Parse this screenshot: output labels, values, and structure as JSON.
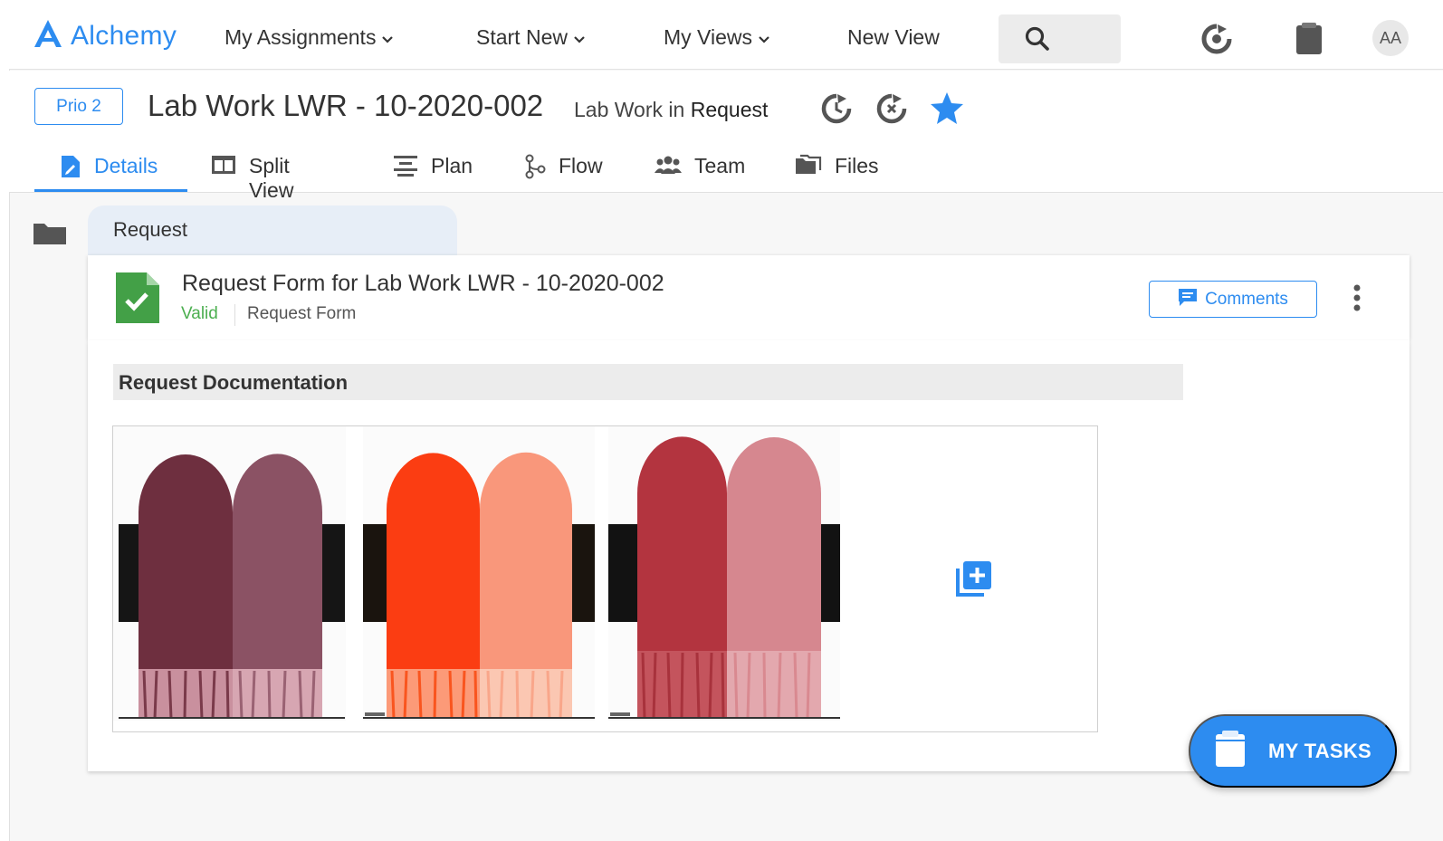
{
  "topnav": {
    "brand": "Alchemy",
    "items": [
      {
        "label": "My Assignments",
        "dropdown": true
      },
      {
        "label": "Start New",
        "dropdown": true
      },
      {
        "label": "My Views",
        "dropdown": true
      },
      {
        "label": "New View",
        "dropdown": false
      }
    ],
    "avatar_initials": "AA"
  },
  "header": {
    "priority": "Prio 2",
    "title": "Lab Work LWR - 10-2020-002",
    "subtitle_prefix": "Lab Work in",
    "subtitle_status": "Request"
  },
  "tabs": [
    {
      "label": "Details",
      "icon": "document-edit-icon",
      "active": true
    },
    {
      "label": "Split View",
      "icon": "split-view-icon",
      "active": false
    },
    {
      "label": "Plan",
      "icon": "plan-icon",
      "active": false
    },
    {
      "label": "Flow",
      "icon": "flow-icon",
      "active": false
    },
    {
      "label": "Team",
      "icon": "team-icon",
      "active": false
    },
    {
      "label": "Files",
      "icon": "files-icon",
      "active": false
    }
  ],
  "section": {
    "label": "Request"
  },
  "form": {
    "title": "Request Form for Lab Work LWR - 10-2020-002",
    "status": "Valid",
    "type": "Request Form",
    "comments_label": "Comments"
  },
  "documentation": {
    "heading": "Request Documentation",
    "swatches": [
      {
        "dark": "#6e2f3f",
        "light": "#8b5264",
        "name": "burgundy"
      },
      {
        "dark": "#fb3d12",
        "light": "#f9977b",
        "name": "orange"
      },
      {
        "dark": "#b3343f",
        "light": "#d6878f",
        "name": "red"
      }
    ]
  },
  "fab": {
    "label": "MY TASKS"
  },
  "colors": {
    "accent": "#2d8cf0",
    "valid": "#4caf50"
  }
}
